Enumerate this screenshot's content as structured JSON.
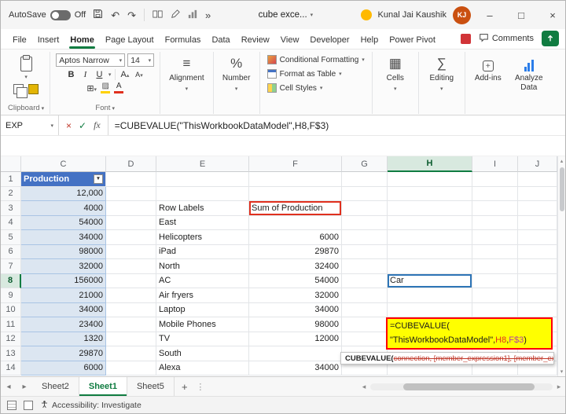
{
  "titlebar": {
    "autosave_label": "AutoSave",
    "autosave_state": "Off",
    "doc_title": "cube exce...",
    "user_name": "Kunal Jai Kaushik",
    "user_initials": "KJ"
  },
  "icons": {
    "chevron_down": "▾",
    "chevron_up": "▴",
    "chevron_left": "◂",
    "chevron_right": "▸",
    "more": "»",
    "undo": "↶",
    "redo": "↷",
    "close": "×",
    "minimize": "–",
    "maximize": "□",
    "cancel": "×",
    "check": "✓",
    "fx": "fx",
    "plus": "+",
    "dots": "⋮",
    "filter": "▼",
    "borders": "⊞",
    "fill": "▨",
    "cells": "▦",
    "editing": "∑",
    "percent": "%",
    "align": "≡",
    "addin_plus": "+"
  },
  "ribbon_tabs": {
    "items": [
      "File",
      "Insert",
      "Home",
      "Page Layout",
      "Formulas",
      "Data",
      "Review",
      "View",
      "Developer",
      "Help",
      "Power Pivot"
    ],
    "active": "Home",
    "comments_label": "Comments"
  },
  "ribbon": {
    "clipboard_label": "Clipboard",
    "font_label": "Font",
    "font_name": "Aptos Narrow",
    "font_size": "14",
    "bold": "B",
    "italic": "I",
    "underline": "U",
    "grow_font": "A",
    "shrink_font": "A",
    "font_color_letter": "A",
    "alignment_label": "Alignment",
    "number_label": "Number",
    "conditional_label": "Conditional Formatting",
    "format_table_label": "Format as Table",
    "cell_styles_label": "Cell Styles",
    "cells_label": "Cells",
    "editing_label": "Editing",
    "addins_label": "Add-ins",
    "analyze_label": "Analyze Data"
  },
  "formula_bar": {
    "name_box": "EXP",
    "formula": "=CUBEVALUE(\"ThisWorkbookDataModel\",H8,F$3)"
  },
  "grid": {
    "columns": [
      "C",
      "D",
      "E",
      "F",
      "G",
      "H",
      "I",
      "J"
    ],
    "selected_column": "H",
    "selected_row": 8,
    "rows": [
      {
        "n": 1,
        "cells": {
          "C": "Production"
        }
      },
      {
        "n": 2,
        "cells": {
          "C": "12,000"
        }
      },
      {
        "n": 3,
        "cells": {
          "C": "4000",
          "E": "Row Labels",
          "F": "Sum of Production"
        }
      },
      {
        "n": 4,
        "cells": {
          "C": "54000",
          "E": "East"
        }
      },
      {
        "n": 5,
        "cells": {
          "C": "34000",
          "E": "Helicopters",
          "F": "6000"
        }
      },
      {
        "n": 6,
        "cells": {
          "C": "98000",
          "E": "iPad",
          "F": "29870"
        }
      },
      {
        "n": 7,
        "cells": {
          "C": "32000",
          "E": "North",
          "F": "32400"
        }
      },
      {
        "n": 8,
        "cells": {
          "C": "156000",
          "E": "AC",
          "F": "54000",
          "H": "Car"
        }
      },
      {
        "n": 9,
        "cells": {
          "C": "21000",
          "E": "Air fryers",
          "F": "32000"
        }
      },
      {
        "n": 10,
        "cells": {
          "C": "34000",
          "E": "Laptop",
          "F": "34000"
        }
      },
      {
        "n": 11,
        "cells": {
          "C": "23400",
          "E": "Mobile Phones",
          "F": "98000"
        }
      },
      {
        "n": 12,
        "cells": {
          "C": "1320",
          "E": "TV",
          "F": "12000"
        }
      },
      {
        "n": 13,
        "cells": {
          "C": "29870",
          "E": "South"
        }
      },
      {
        "n": 14,
        "cells": {
          "C": "6000",
          "E": "Alexa",
          "F": "34000"
        }
      }
    ]
  },
  "formula_edit": {
    "line1": "=CUBEVALUE(",
    "line2_pre": "\"ThisWorkbookDataModel\",",
    "ref1": "H8",
    "sep": ",",
    "ref2": "F$3",
    "close": ")"
  },
  "tooltip": {
    "prefix": "CUBEVALUE(",
    "args": "connection, [member_expression1], [member_expres..."
  },
  "sheets": {
    "items": [
      "Sheet2",
      "Sheet1",
      "Sheet5"
    ],
    "active": "Sheet1",
    "add_label": "+"
  },
  "status_bar": {
    "accessibility": "Accessibility: Investigate"
  },
  "colors": {
    "excel_green": "#107C41",
    "table_header_blue": "#4472C4",
    "table_fill_blue": "#DCE6F1",
    "highlight_yellow": "#FFFF00",
    "ref_red": "#E0301E",
    "ref_purple": "#B03DA6",
    "selection_blue": "#2E75B6"
  }
}
